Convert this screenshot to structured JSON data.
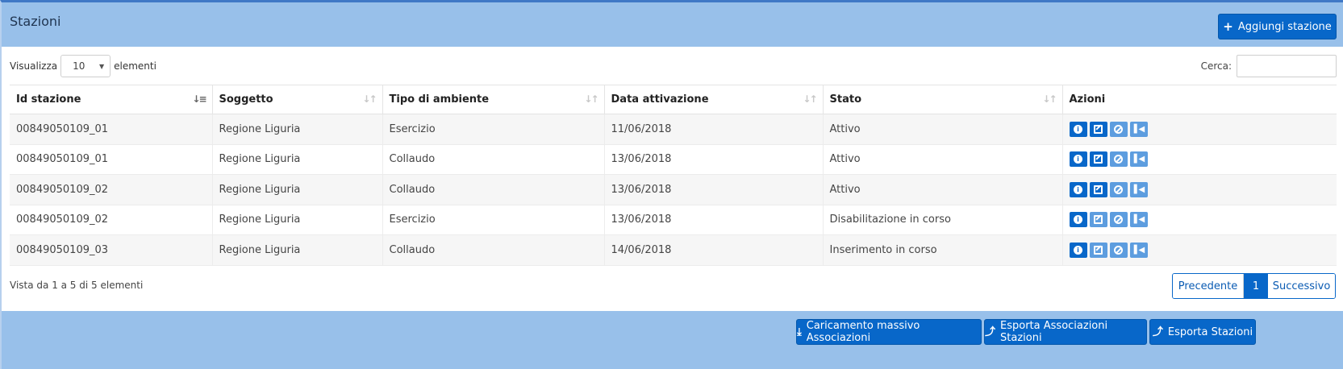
{
  "header": {
    "title": "Stazioni",
    "add_button_label": "Aggiungi stazione"
  },
  "controls": {
    "show_label": "Visualizza",
    "page_length": "10",
    "elements_label": "elementi",
    "search_label": "Cerca:",
    "search_value": ""
  },
  "table": {
    "columns": [
      "Id stazione",
      "Soggetto",
      "Tipo di ambiente",
      "Data attivazione",
      "Stato",
      "Azioni"
    ],
    "rows": [
      {
        "id": "00849050109_01",
        "soggetto": "Regione Liguria",
        "tipo": "Esercizio",
        "data": "11/06/2018",
        "stato": "Attivo",
        "edit_enabled": true
      },
      {
        "id": "00849050109_01",
        "soggetto": "Regione Liguria",
        "tipo": "Collaudo",
        "data": "13/06/2018",
        "stato": "Attivo",
        "edit_enabled": true
      },
      {
        "id": "00849050109_02",
        "soggetto": "Regione Liguria",
        "tipo": "Collaudo",
        "data": "13/06/2018",
        "stato": "Attivo",
        "edit_enabled": true
      },
      {
        "id": "00849050109_02",
        "soggetto": "Regione Liguria",
        "tipo": "Esercizio",
        "data": "13/06/2018",
        "stato": "Disabilitazione in corso",
        "edit_enabled": false
      },
      {
        "id": "00849050109_03",
        "soggetto": "Regione Liguria",
        "tipo": "Collaudo",
        "data": "14/06/2018",
        "stato": "Inserimento in corso",
        "edit_enabled": false
      }
    ],
    "action_icons": [
      "info-icon",
      "edit-icon",
      "ban-icon",
      "skip-icon"
    ]
  },
  "footer_info": "Vista da 1 a 5 di 5 elementi",
  "pagination": {
    "prev": "Precedente",
    "current": "1",
    "next": "Successivo"
  },
  "footer": {
    "caricamento_label": "Caricamento massivo Associazioni",
    "esporta_assoc_label": "Esporta Associazioni Stazioni",
    "esporta_stazioni_label": "Esporta Stazioni"
  },
  "colors": {
    "header_bg": "#98c0ea",
    "primary": "#0867c9",
    "primary_light": "#5d9ddf"
  }
}
